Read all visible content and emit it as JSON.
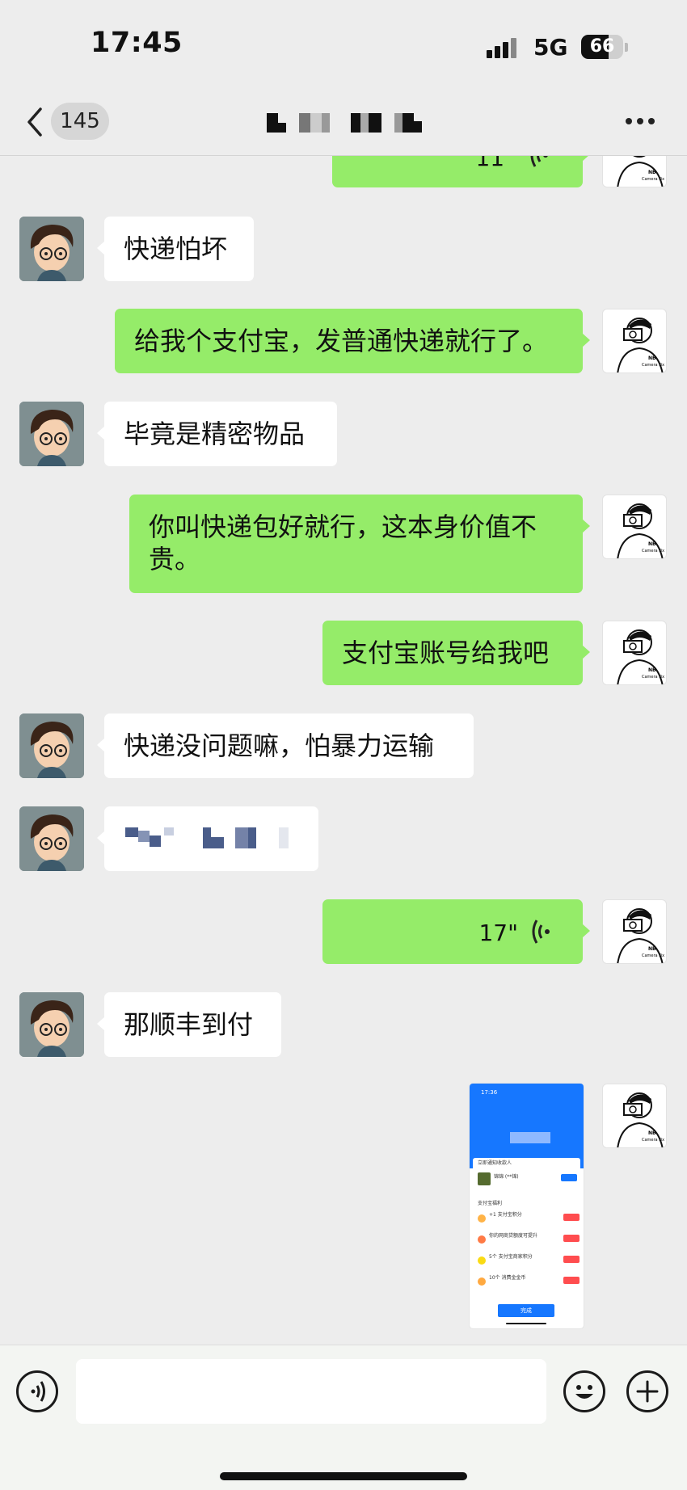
{
  "status_bar": {
    "time": "17:45",
    "network": "5G",
    "battery_level": "66",
    "battery_fraction": 0.66
  },
  "nav": {
    "unread_count": "145",
    "title": ""
  },
  "messages": [
    {
      "side": "out",
      "type": "voice",
      "duration": "11\""
    },
    {
      "side": "in",
      "type": "text",
      "text": "快递怕坏"
    },
    {
      "side": "out",
      "type": "text",
      "text": "给我个支付宝，发普通快递就行了。"
    },
    {
      "side": "in",
      "type": "text",
      "text": "毕竟是精密物品"
    },
    {
      "side": "out",
      "type": "text",
      "lines": [
        "你叫快递包好就行，这本身价值不",
        "贵。"
      ]
    },
    {
      "side": "out",
      "type": "text",
      "text": "支付宝账号给我吧"
    },
    {
      "side": "in",
      "type": "text",
      "text": "快递没问题嘛，怕暴力运输"
    },
    {
      "side": "in",
      "type": "text",
      "text": ""
    },
    {
      "side": "out",
      "type": "voice",
      "duration": "17\""
    },
    {
      "side": "in",
      "type": "text",
      "text": "那顺丰到付"
    },
    {
      "side": "out",
      "type": "image",
      "image": {
        "time": "17:36",
        "section_title": "立即通知收款人",
        "contact_name": "锦锦 (**锦)",
        "benefits_title": "支付宝福利",
        "rows": [
          "+1 支付宝积分",
          "你的网商贷额度可提升",
          "5个 支付宝商家积分",
          "10个 消费金金币"
        ],
        "done_label": "完成"
      }
    }
  ],
  "input": {
    "placeholder": "",
    "value": ""
  },
  "icons": {
    "back": "chevron-left-icon",
    "more": "more-dots-icon",
    "voice": "voice-wave-icon",
    "emoji": "smiley-icon",
    "plus": "plus-icon"
  },
  "colors": {
    "background": "#ededed",
    "outgoing_bubble": "#95ec69",
    "incoming_bubble": "#ffffff",
    "alipay_blue": "#1677ff"
  }
}
